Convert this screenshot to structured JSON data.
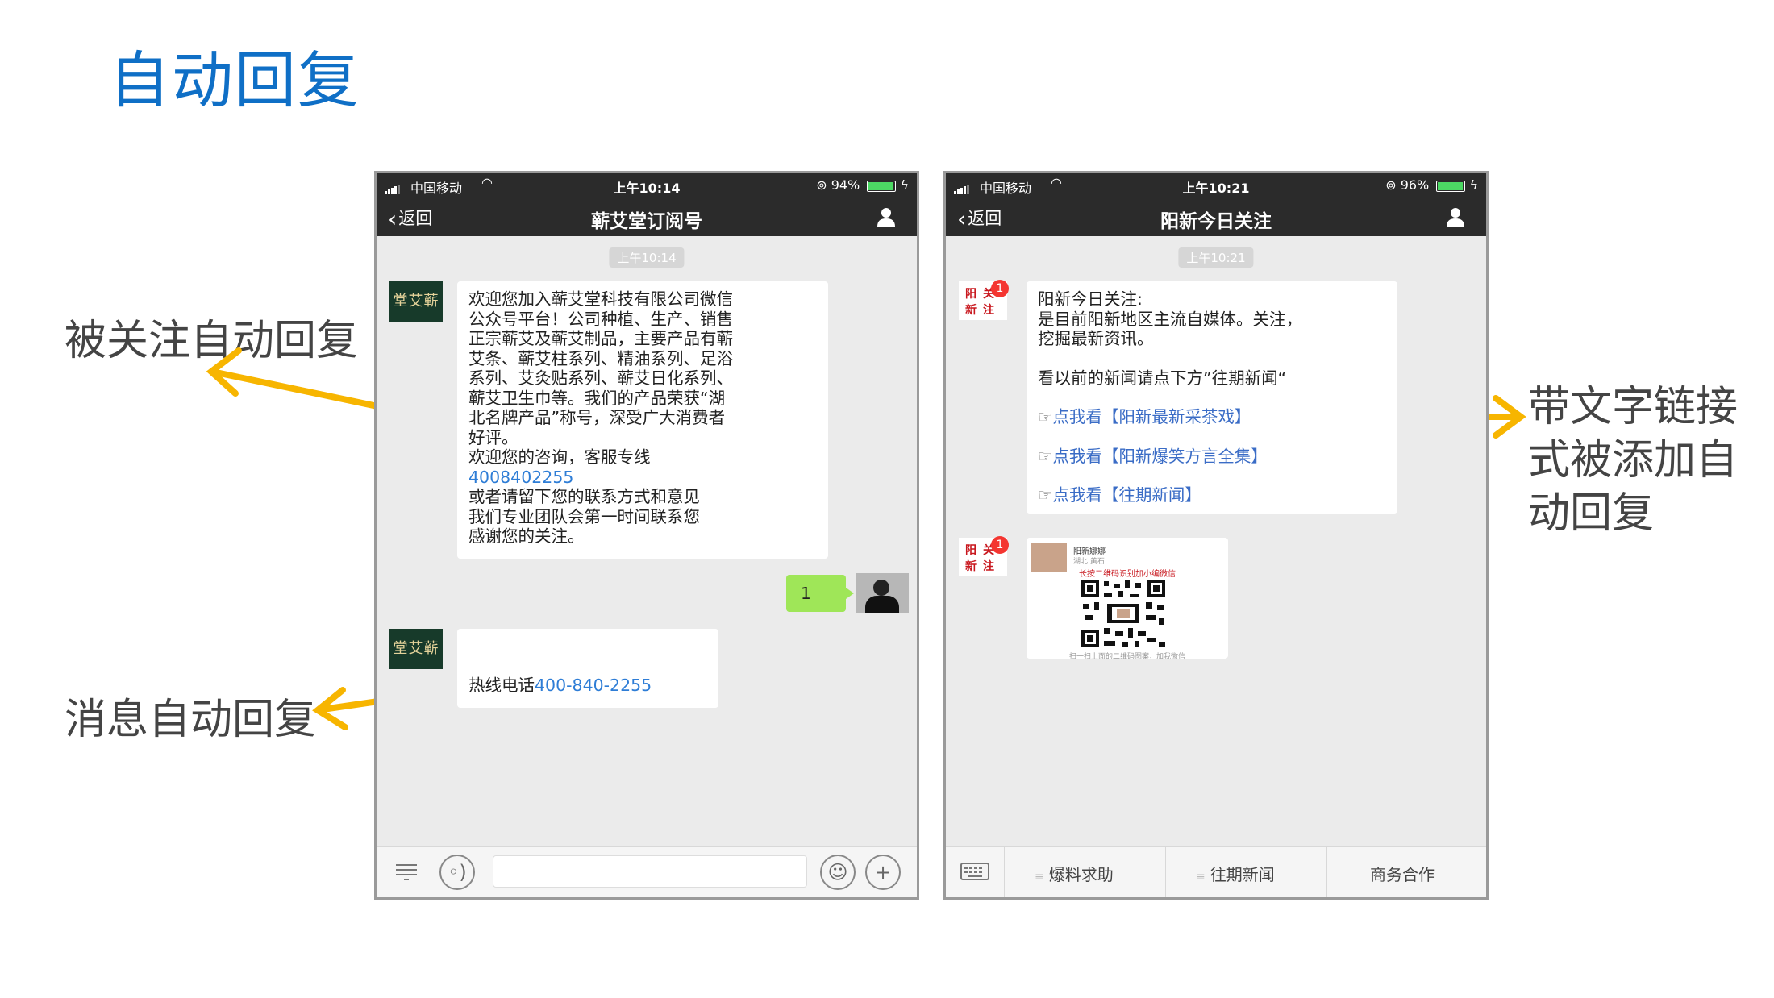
{
  "slide": {
    "title": "自动回复",
    "label_follow": "被关注自动回复",
    "label_message": "消息自动回复",
    "label_link_line1": "带文字链接",
    "label_link_line2": "式被添加自",
    "label_link_line3": "动回复",
    "arrow_color": "#f7b500"
  },
  "phone_a": {
    "status": {
      "carrier": "中国移动",
      "time": "上午10:14",
      "battery": "94%",
      "battery_level": 0.94
    },
    "nav": {
      "back": "返回",
      "title": "蕲艾堂订阅号"
    },
    "timestamp": "上午10:14",
    "avatar_text": "堂艾蕲",
    "welcome": {
      "line1": "欢迎您加入蕲艾堂科技有限公司微信",
      "line2": "公众号平台！公司种植、生产、销售",
      "line3": "正宗蕲艾及蕲艾制品，主要产品有蕲",
      "line4": "艾条、蕲艾柱系列、精油系列、足浴",
      "line5": "系列、艾灸贴系列、蕲艾日化系列、",
      "line6": "蕲艾卫生巾等。我们的产品荣获“湖",
      "line7": "北名牌产品”称号，深受广大消费者",
      "line8": "好评。",
      "line9": "欢迎您的咨询，客服专线",
      "phone": "4008402255",
      "line10": "或者请留下您的联系方式和意见",
      "line11": "我们专业团队会第一时间联系您",
      "line12": "感谢您的关注。"
    },
    "my_message": "1",
    "reply": {
      "prefix": "热线电话",
      "phone": "400-840-2255"
    }
  },
  "phone_b": {
    "status": {
      "carrier": "中国移动",
      "time": "上午10:21",
      "battery": "96%",
      "battery_level": 0.96
    },
    "nav": {
      "back": "返回",
      "title": "阳新今日关注"
    },
    "timestamp": "上午10:21",
    "avatar_chars": [
      "阳",
      "关",
      "新",
      "注"
    ],
    "badge": "1",
    "msg": {
      "line1": "阳新今日关注:",
      "line2": "是目前阳新地区主流自媒体。关注，",
      "line3": "挖掘最新资讯。",
      "line4": "看以前的新闻请点下方”往期新闻“",
      "link_hand": "☞",
      "link1": "点我看【阳新最新采茶戏】",
      "link2": "点我看【阳新爆笑方言全集】",
      "link3": "点我看【往期新闻】"
    },
    "card": {
      "name": "阳新娜娜",
      "location": "湖北 黄石",
      "tip": "长按二维码识别加小编微信",
      "footer": "扫一扫上面的二维码图案，加我微信"
    },
    "menu": [
      "爆料求助",
      "往期新闻",
      "商务合作"
    ]
  }
}
